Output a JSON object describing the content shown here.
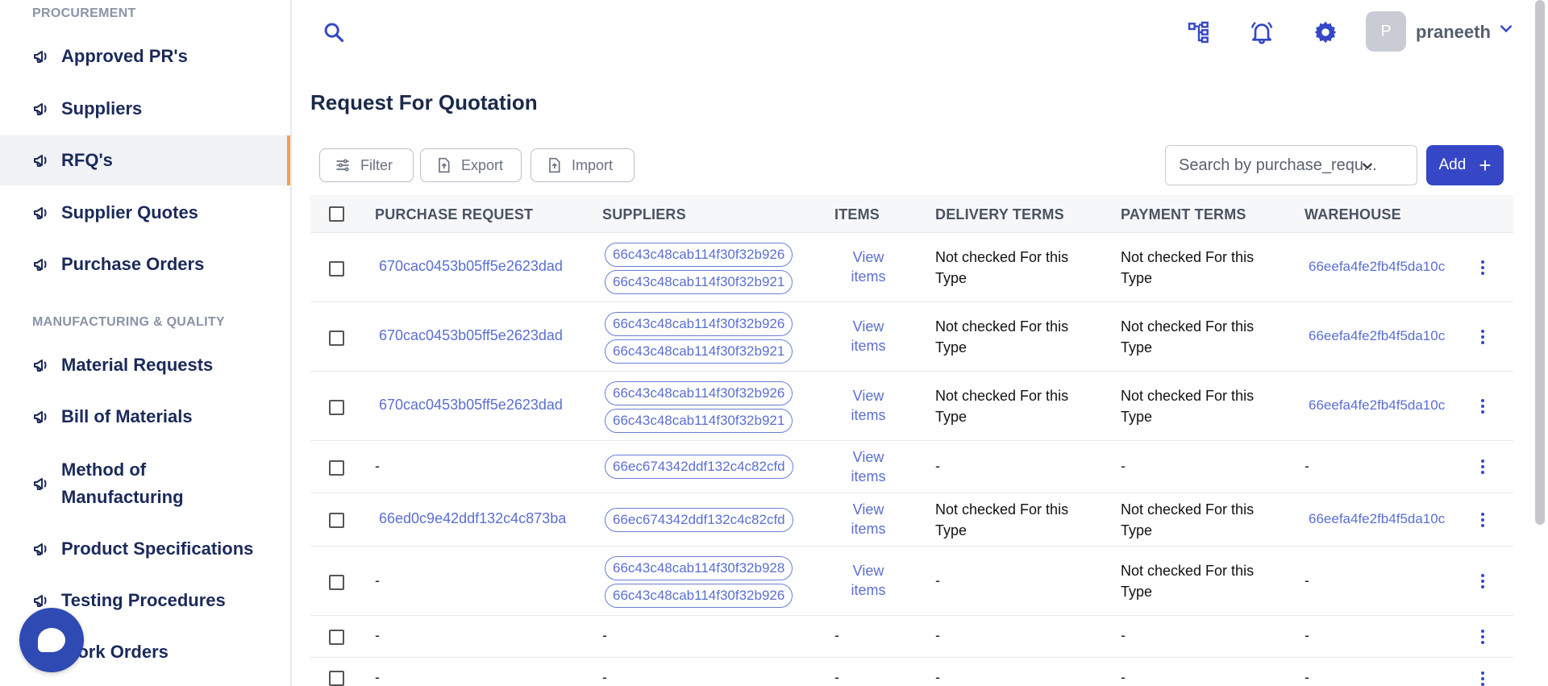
{
  "sidebar": {
    "section_procurement": "PROCUREMENT",
    "section_manufacturing": "MANUFACTURING & QUALITY",
    "procurement_items": [
      "Approved PR's",
      "Suppliers",
      "RFQ's",
      "Supplier Quotes",
      "Purchase Orders"
    ],
    "manufacturing_items": [
      "Material Requests",
      "Bill of Materials",
      "Method of Manufacturing",
      "Product Specifications",
      "Testing Procedures",
      "Work Orders"
    ],
    "active_item": "RFQ's"
  },
  "topbar": {
    "username": "praneeth",
    "avatar_initial": "P"
  },
  "page": {
    "title": "Request For Quotation"
  },
  "toolbar": {
    "filter_label": "Filter",
    "export_label": "Export",
    "import_label": "Import",
    "search_placeholder": "Search by purchase_requ...",
    "add_label": "Add"
  },
  "table": {
    "headers": [
      "PURCHASE REQUEST",
      "SUPPLIERS",
      "ITEMS",
      "DELIVERY TERMS",
      "PAYMENT TERMS",
      "WAREHOUSE"
    ],
    "view_label_1": "View",
    "view_label_2": "items",
    "rows": [
      {
        "pr": "670cac0453b05ff5e2623dad",
        "suppliers": [
          "66c43c48cab114f30f32b926",
          "66c43c48cab114f30f32b921"
        ],
        "delivery": "Not checked For this Type",
        "payment": "Not checked For this Type",
        "warehouse": "66eefa4fe2fb4f5da10c"
      },
      {
        "pr": "670cac0453b05ff5e2623dad",
        "suppliers": [
          "66c43c48cab114f30f32b926",
          "66c43c48cab114f30f32b921"
        ],
        "delivery": "Not checked For this Type",
        "payment": "Not checked For this Type",
        "warehouse": "66eefa4fe2fb4f5da10c"
      },
      {
        "pr": "670cac0453b05ff5e2623dad",
        "suppliers": [
          "66c43c48cab114f30f32b926",
          "66c43c48cab114f30f32b921"
        ],
        "delivery": "Not checked For this Type",
        "payment": "Not checked For this Type",
        "warehouse": "66eefa4fe2fb4f5da10c"
      },
      {
        "pr": "-",
        "suppliers": [
          "66ec674342ddf132c4c82cfd"
        ],
        "delivery": "-",
        "payment": "-",
        "warehouse": "-"
      },
      {
        "pr": "66ed0c9e42ddf132c4c873ba",
        "suppliers": [
          "66ec674342ddf132c4c82cfd"
        ],
        "delivery": "Not checked For this Type",
        "payment": "Not checked For this Type",
        "warehouse": "66eefa4fe2fb4f5da10c"
      },
      {
        "pr": "-",
        "suppliers": [
          "66c43c48cab114f30f32b928",
          "66c43c48cab114f30f32b926"
        ],
        "delivery": "-",
        "payment": "Not checked For this Type",
        "warehouse": "-"
      },
      {
        "pr": "-",
        "suppliers": [],
        "items": "-",
        "delivery": "-",
        "payment": "-",
        "warehouse": "-"
      },
      {
        "pr": "-",
        "suppliers": [],
        "items": "-",
        "delivery": "-",
        "payment": "-",
        "warehouse": "-"
      }
    ]
  },
  "colors": {
    "accent": "#3547c7",
    "link": "#5b6fd0",
    "active_indicator": "#f5a04a"
  },
  "icons": [
    "megaphone-icon",
    "search-icon",
    "hierarchy-icon",
    "bell-icon",
    "gear-icon",
    "chevron-down-icon",
    "filter-icon",
    "export-icon",
    "import-icon",
    "kebab-icon",
    "chat-icon"
  ]
}
